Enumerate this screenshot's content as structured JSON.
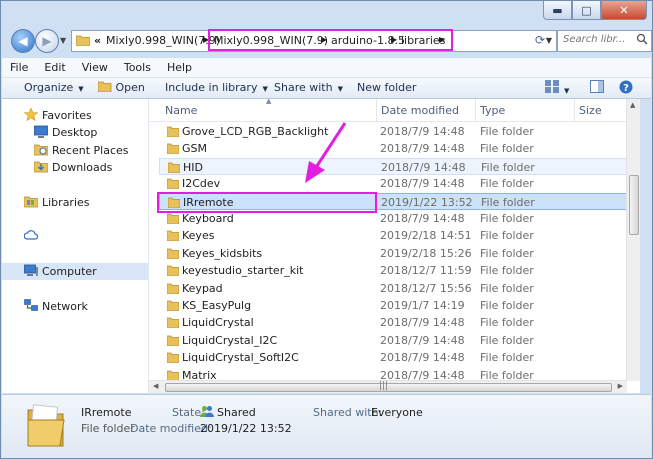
{
  "window": {
    "caption": {
      "minimize": "▬",
      "maximize": "□",
      "close": "✕"
    }
  },
  "address": {
    "raquo": "«",
    "segments": [
      "Mixly0.998_WIN(7.9)",
      "Mixly0.998_WIN(7.9)",
      "arduino-1.8.5",
      "libraries"
    ],
    "separator": "▶",
    "highlight_color": "#e41ee0"
  },
  "search": {
    "placeholder": "Search libr..."
  },
  "menu": [
    "File",
    "Edit",
    "View",
    "Tools",
    "Help"
  ],
  "toolbar": {
    "organize": "Organize",
    "open": "Open",
    "include": "Include in library",
    "share": "Share with",
    "newfolder": "New folder"
  },
  "nav": {
    "favorites": "Favorites",
    "desktop": "Desktop",
    "recent": "Recent Places",
    "downloads": "Downloads",
    "libraries": "Libraries",
    "computer": "Computer",
    "network": "Network"
  },
  "columns": {
    "name": "Name",
    "date": "Date modified",
    "type": "Type",
    "size": "Size"
  },
  "files": [
    {
      "name": "Grove_LCD_RGB_Backlight",
      "date": "2018/7/9 14:48",
      "type": "File folder"
    },
    {
      "name": "GSM",
      "date": "2018/7/9 14:48",
      "type": "File folder"
    },
    {
      "name": "HID",
      "date": "2018/7/9 14:48",
      "type": "File folder"
    },
    {
      "name": "I2Cdev",
      "date": "2018/7/9 14:48",
      "type": "File folder"
    },
    {
      "name": "IRremote",
      "date": "2019/1/22 13:52",
      "type": "File folder"
    },
    {
      "name": "Keyboard",
      "date": "2018/7/9 14:48",
      "type": "File folder"
    },
    {
      "name": "Keyes",
      "date": "2019/2/18 14:51",
      "type": "File folder"
    },
    {
      "name": "Keyes_kidsbits",
      "date": "2019/2/18 15:26",
      "type": "File folder"
    },
    {
      "name": "keyestudio_starter_kit",
      "date": "2018/12/7 11:59",
      "type": "File folder"
    },
    {
      "name": "Keypad",
      "date": "2018/12/7 15:56",
      "type": "File folder"
    },
    {
      "name": "KS_EasyPulg",
      "date": "2019/1/7 14:19",
      "type": "File folder"
    },
    {
      "name": "LiquidCrystal",
      "date": "2018/7/9 14:48",
      "type": "File folder"
    },
    {
      "name": "LiquidCrystal_I2C",
      "date": "2018/7/9 14:48",
      "type": "File folder"
    },
    {
      "name": "LiquidCrystal_SoftI2C",
      "date": "2018/7/9 14:48",
      "type": "File folder"
    },
    {
      "name": "Matrix",
      "date": "2018/7/9 14:48",
      "type": "File folder"
    }
  ],
  "hovered_index": 2,
  "selected_index": 4,
  "details": {
    "name": "IRremote",
    "type": "File folder",
    "state_label": "State:",
    "state_value": "Shared",
    "modified_label": "Date modified:",
    "modified_value": "2019/1/22 13:52",
    "shared_label": "Shared with:",
    "shared_value": "Everyone"
  },
  "colors": {
    "annotation": "#e41ee0",
    "selection": "#cce1fa",
    "folder": "#e8c15a"
  }
}
